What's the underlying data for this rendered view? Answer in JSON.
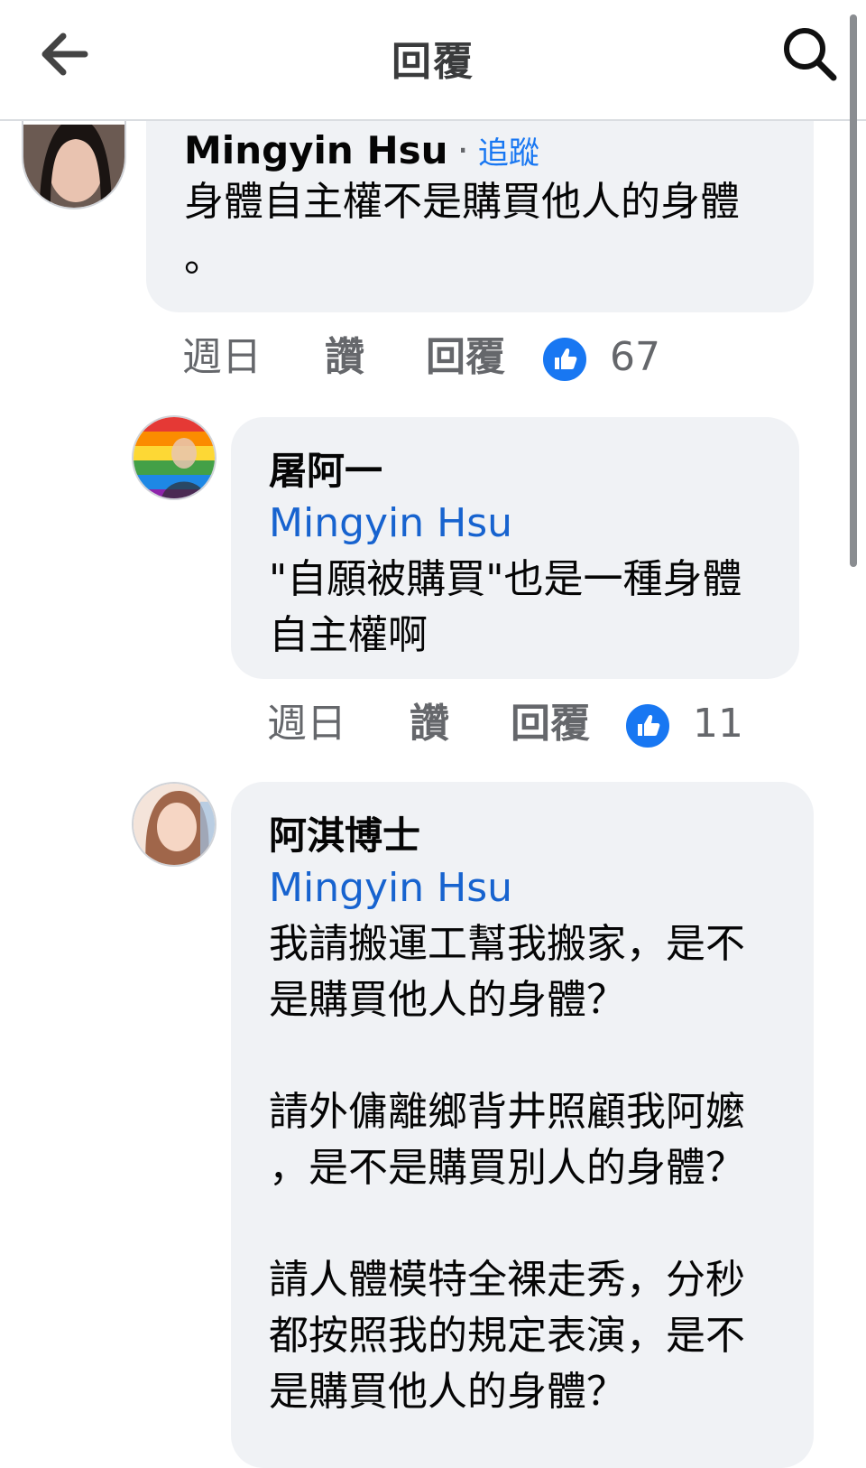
{
  "header": {
    "title": "回覆",
    "back_icon": "back-arrow-icon",
    "search_icon": "search-icon"
  },
  "comments": [
    {
      "author": "Mingyin Hsu",
      "separator": "·",
      "follow_label": "追蹤",
      "text": "身體自主權不是購買他人的身體\n。",
      "time": "週日",
      "like_label": "讚",
      "reply_label": "回覆",
      "reaction_icon": "like-thumb-icon",
      "reaction_count": "67"
    },
    {
      "author": "屠阿一",
      "mention": "Mingyin Hsu",
      "text": "\"自願被購買\"也是一種身體\n自主權啊",
      "time": "週日",
      "like_label": "讚",
      "reply_label": "回覆",
      "reaction_icon": "like-thumb-icon",
      "reaction_count": "11"
    },
    {
      "author": "阿淇博士",
      "mention": "Mingyin Hsu",
      "text": "我請搬運工幫我搬家，是不\n是購買他人的身體？\n\n請外傭離鄉背井照顧我阿嬤\n，是不是購買別人的身體？\n\n請人體模特全裸走秀，分秒\n都按照我的規定表演，是不\n是購買他人的身體？"
    }
  ],
  "colors": {
    "accent": "#1877f2",
    "bubble": "#f0f2f5",
    "meta_text": "#65676b"
  }
}
